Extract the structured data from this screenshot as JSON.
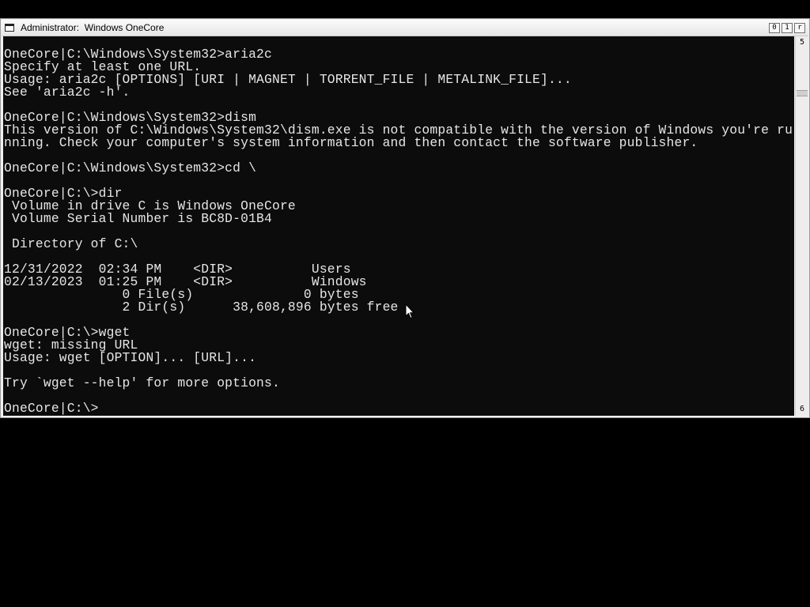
{
  "window": {
    "title": "Administrator:  Windows OneCore",
    "buttons": {
      "minimize": "0",
      "maximize": "1",
      "close": "r"
    }
  },
  "console": {
    "lines": [
      "OneCore|C:\\Windows\\System32>aria2c",
      "Specify at least one URL.",
      "Usage: aria2c [OPTIONS] [URI | MAGNET | TORRENT_FILE | METALINK_FILE]...",
      "See 'aria2c -h'.",
      "",
      "OneCore|C:\\Windows\\System32>dism",
      "This version of C:\\Windows\\System32\\dism.exe is not compatible with the version of Windows you're ru",
      "nning. Check your computer's system information and then contact the software publisher.",
      "",
      "OneCore|C:\\Windows\\System32>cd \\",
      "",
      "OneCore|C:\\>dir",
      " Volume in drive C is Windows OneCore",
      " Volume Serial Number is BC8D-01B4",
      "",
      " Directory of C:\\",
      "",
      "12/31/2022  02:34 PM    <DIR>          Users",
      "02/13/2023  01:25 PM    <DIR>          Windows",
      "               0 File(s)              0 bytes",
      "               2 Dir(s)      38,608,896 bytes free",
      "",
      "OneCore|C:\\>wget",
      "wget: missing URL",
      "Usage: wget [OPTION]... [URL]...",
      "",
      "Try `wget --help' for more options.",
      "",
      "OneCore|C:\\>"
    ],
    "text_color": "#e6e6e6",
    "background_color": "#0c0c0c"
  },
  "scrollbar": {
    "up_glyph": "5",
    "down_glyph": "6"
  },
  "cursor": {
    "icon": "mouse-pointer-icon"
  }
}
